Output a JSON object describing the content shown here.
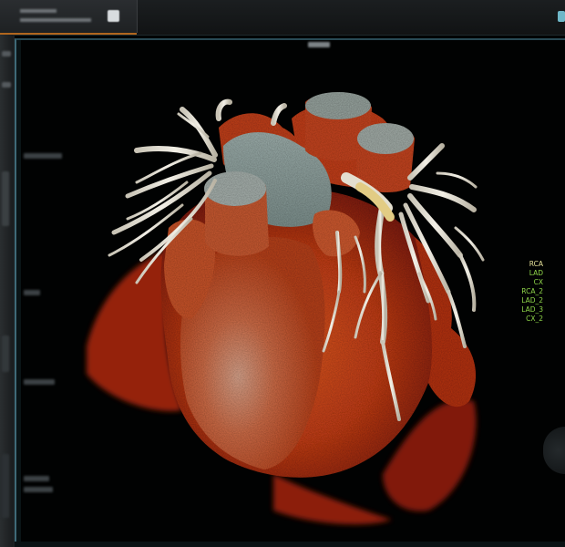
{
  "app": {
    "tab_label": "",
    "viewport_title": ""
  },
  "legend": {
    "items": [
      {
        "label": "RCA",
        "color": "#e6e29a"
      },
      {
        "label": "LAD",
        "color": "#8fd64a"
      },
      {
        "label": "CX",
        "color": "#8fd64a"
      },
      {
        "label": "RCA_2",
        "color": "#8fd64a"
      },
      {
        "label": "LAD_2",
        "color": "#8fd64a"
      },
      {
        "label": "LAD_3",
        "color": "#8fd64a"
      },
      {
        "label": "CX_2",
        "color": "#8fd64a"
      }
    ]
  },
  "colors": {
    "accent_tab": "#b0661e",
    "viewport_border": "#3f6a78",
    "myocardium": "#c2401a",
    "vessels": "#e9e6dc",
    "lumen": "#9aa5a1"
  },
  "icons": {
    "tab_icon": "window-icon",
    "top_right_icon": "panel-toggle-icon",
    "scroll_knob": "rotate-knob-icon"
  }
}
